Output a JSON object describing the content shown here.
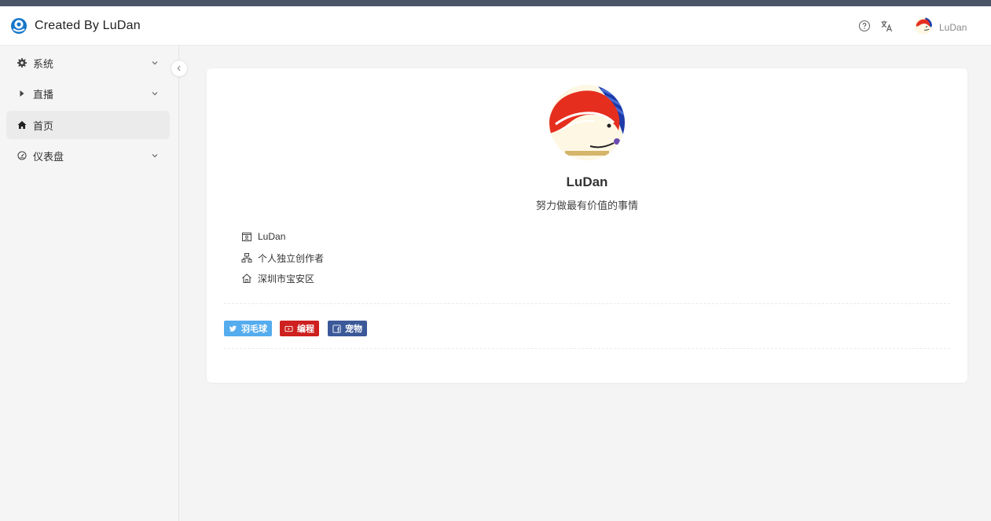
{
  "header": {
    "brand": "Created By LuDan",
    "user_name": "LuDan",
    "icons": [
      "help-circle-icon",
      "translate-icon"
    ]
  },
  "sidebar": {
    "items": [
      {
        "label": "系统",
        "icon": "gear-icon",
        "expandable": true,
        "active": false
      },
      {
        "label": "直播",
        "icon": "play-icon",
        "expandable": true,
        "active": false
      },
      {
        "label": "首页",
        "icon": "home-icon",
        "expandable": false,
        "active": true
      },
      {
        "label": "仪表盘",
        "icon": "dashboard-icon",
        "expandable": true,
        "active": false
      }
    ]
  },
  "profile": {
    "name": "LuDan",
    "motto": "努力做最有价值的事情",
    "info": [
      {
        "icon": "id-card-icon",
        "text": "LuDan"
      },
      {
        "icon": "org-chart-icon",
        "text": "个人独立创作者"
      },
      {
        "icon": "home-icon",
        "text": "深圳市宝安区"
      }
    ],
    "tags": [
      {
        "label": "羽毛球",
        "icon": "twitter-icon",
        "color": "#55acee"
      },
      {
        "label": "编程",
        "icon": "youtube-icon",
        "color": "#cd201f"
      },
      {
        "label": "宠物",
        "icon": "facebook-icon",
        "color": "#3b5999"
      }
    ]
  },
  "colors": {
    "accent_twitter": "#55acee",
    "accent_youtube": "#cd201f",
    "accent_facebook": "#3b5999",
    "header_strip": "#4a5568"
  }
}
